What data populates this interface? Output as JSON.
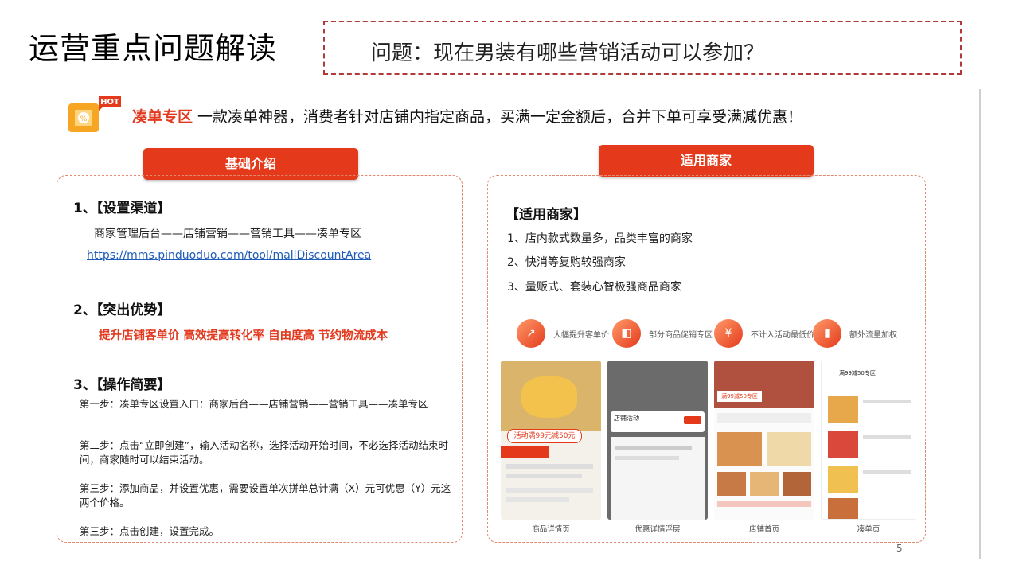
{
  "title": "运营重点问题解读",
  "question": "问题：现在男装有哪些营销活动可以参加？",
  "hot_badge": "HOT",
  "intro": {
    "highlight": "凑单专区",
    "text": " 一款凑单神器，消费者针对店铺内指定商品，买满一定金额后，合并下单可享受满减优惠！"
  },
  "left_panel": {
    "header": "基础介绍",
    "s1_title": "1、【设置渠道】",
    "s1_path": "商家管理后台——店铺营销——营销工具——凑单专区",
    "s1_link": "https://mms.pinduoduo.com/tool/mallDiscountArea",
    "s2_title": "2、【突出优势】",
    "s2_text": "提升店铺客单价  高效提高转化率  自由度高 节约物流成本",
    "s3_title": "3、【操作简要】",
    "step1": "第一步：凑单专区设置入口：商家后台——店铺营销——营销工具——凑单专区",
    "step2": "第二步：点击“立即创建”，输入活动名称，选择活动开始时间，不必选择活动结束时间，商家随时可以结束活动。",
    "step3": "第三步：添加商品，并设置优惠，需要设置单次拼单总计满（X）元可优惠（Y）元这两个价格。",
    "step4": "第三步：点击创建，设置完成。"
  },
  "right_panel": {
    "header": "适用商家",
    "title": "【适用商家】",
    "item1": "1、店内款式数量多，品类丰富的商家",
    "item2": "2、快消等复购较强商家",
    "item3": "3、量贩式、套装心智极强商品商家",
    "features": [
      {
        "icon": "growth-icon",
        "label": "大幅提升客单价"
      },
      {
        "icon": "bag-icon",
        "label": "部分商品促销专区"
      },
      {
        "icon": "coupon-icon",
        "label": "不计入活动最低价"
      },
      {
        "icon": "bar-chart-icon",
        "label": "额外流量加权"
      }
    ],
    "shots": [
      {
        "caption": "商品详情页",
        "banner": "活动满99元减50元"
      },
      {
        "caption": "优惠详情浮层",
        "banner": "店铺活动"
      },
      {
        "caption": "店铺首页",
        "banner": "满99减50专区"
      },
      {
        "caption": "凑单页",
        "banner": "满99减50专区"
      }
    ]
  },
  "page_number": "5",
  "colors": {
    "accent": "#e43a1b",
    "link": "#1f5bb8",
    "border": "#e08a70"
  }
}
